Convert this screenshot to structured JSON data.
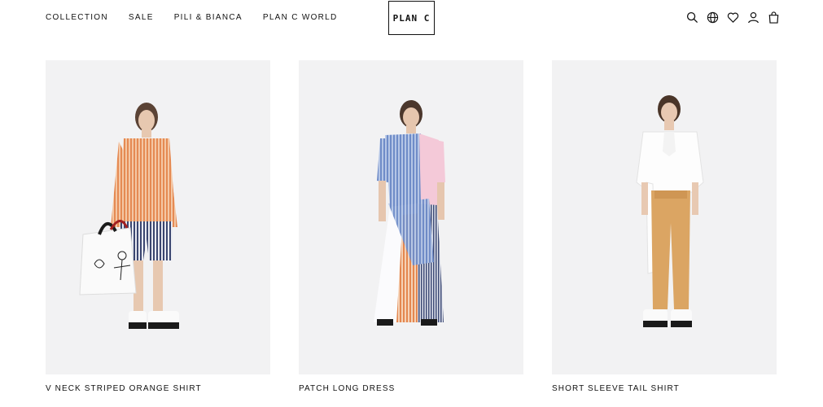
{
  "header": {
    "nav": [
      {
        "label": "COLLECTION"
      },
      {
        "label": "SALE"
      },
      {
        "label": "PILI & BIANCA"
      },
      {
        "label": "PLAN C WORLD"
      }
    ],
    "logo": "PLAN C",
    "icons": [
      "search-icon",
      "globe-icon",
      "heart-icon",
      "user-icon",
      "bag-icon"
    ]
  },
  "products": [
    {
      "name": "V NECK STRIPED ORANGE SHIRT"
    },
    {
      "name": "PATCH LONG DRESS"
    },
    {
      "name": "SHORT SLEEVE TAIL SHIRT"
    }
  ],
  "colors": {
    "text": "#111111",
    "image_bg": "#f2f2f3",
    "accent_orange": "#e8a276",
    "accent_blue": "#8aa5d6",
    "accent_pink": "#f2c9d6",
    "accent_tan": "#d9a565"
  }
}
